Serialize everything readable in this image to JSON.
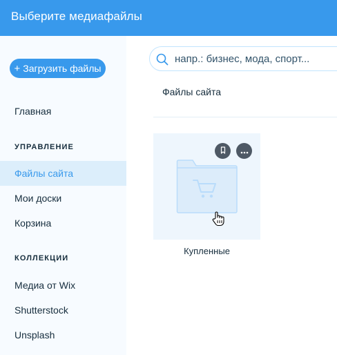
{
  "header": {
    "title": "Выберите медиафайлы"
  },
  "sidebar": {
    "upload_button": {
      "plus": "+",
      "label": "Загрузить файлы"
    },
    "home": "Главная",
    "manage_section": "УПРАВЛЕНИЕ",
    "manage_items": [
      "Файлы сайта",
      "Мои доски",
      "Корзина"
    ],
    "collections_section": "КОЛЛЕКЦИИ",
    "collection_items": [
      "Медиа от Wix",
      "Shutterstock",
      "Unsplash"
    ]
  },
  "search": {
    "placeholder": "напр.: бизнес, мода, спорт..."
  },
  "breadcrumb": "Файлы сайта",
  "folders": [
    {
      "name": "Купленные",
      "icon": "shopping-cart-folder-icon"
    }
  ],
  "colors": {
    "accent": "#3899ec",
    "sidebar_bg": "#f7fbff",
    "active_bg": "#dceefb",
    "text": "#162d3d"
  }
}
